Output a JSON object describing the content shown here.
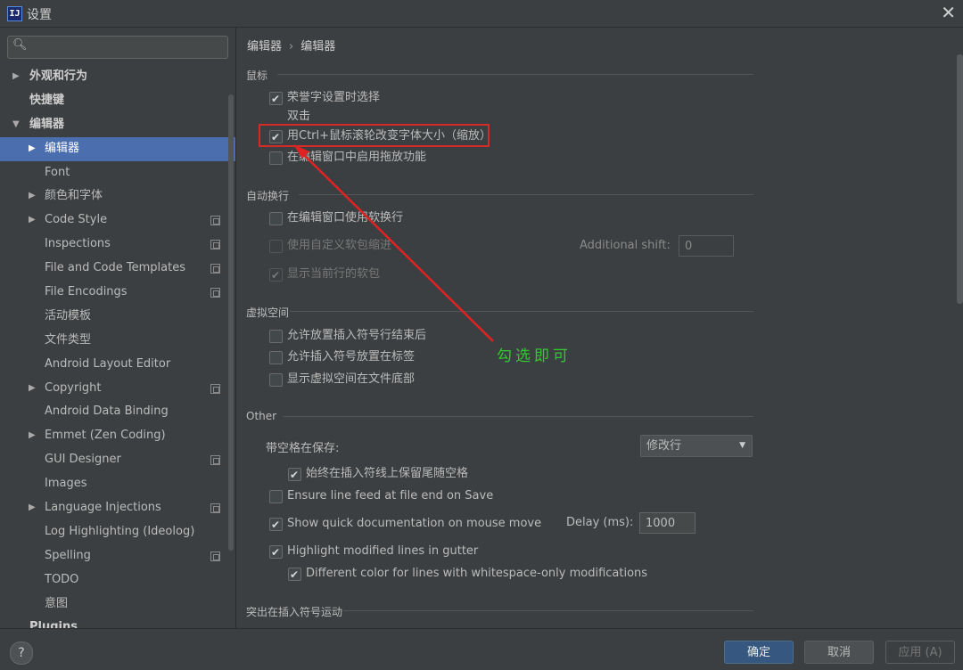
{
  "window": {
    "title": "设置",
    "app_icon": "IJ",
    "close_glyph": "✕"
  },
  "search": {
    "placeholder": "",
    "icon": "search-icon"
  },
  "tree": [
    {
      "label": "外观和行为",
      "level": 0,
      "arrow": "▶",
      "bold": true
    },
    {
      "label": "快捷键",
      "level": 0,
      "arrow": "",
      "bold": true
    },
    {
      "label": "编辑器",
      "level": 0,
      "arrow": "▼",
      "bold": true
    },
    {
      "label": "编辑器",
      "level": 1,
      "arrow": "▶",
      "selected": true
    },
    {
      "label": "Font",
      "level": 1,
      "arrow": ""
    },
    {
      "label": "颜色和字体",
      "level": 1,
      "arrow": "▶"
    },
    {
      "label": "Code Style",
      "level": 1,
      "arrow": "▶",
      "copy": true
    },
    {
      "label": "Inspections",
      "level": 1,
      "arrow": "",
      "copy": true
    },
    {
      "label": "File and Code Templates",
      "level": 1,
      "arrow": "",
      "copy": true
    },
    {
      "label": "File Encodings",
      "level": 1,
      "arrow": "",
      "copy": true
    },
    {
      "label": "活动模板",
      "level": 1,
      "arrow": ""
    },
    {
      "label": "文件类型",
      "level": 1,
      "arrow": ""
    },
    {
      "label": "Android Layout Editor",
      "level": 1,
      "arrow": ""
    },
    {
      "label": "Copyright",
      "level": 1,
      "arrow": "▶",
      "copy": true
    },
    {
      "label": "Android Data Binding",
      "level": 1,
      "arrow": ""
    },
    {
      "label": "Emmet (Zen Coding)",
      "level": 1,
      "arrow": "▶"
    },
    {
      "label": "GUI Designer",
      "level": 1,
      "arrow": "",
      "copy": true
    },
    {
      "label": "Images",
      "level": 1,
      "arrow": ""
    },
    {
      "label": "Language Injections",
      "level": 1,
      "arrow": "▶",
      "copy": true
    },
    {
      "label": "Log Highlighting (Ideolog)",
      "level": 1,
      "arrow": ""
    },
    {
      "label": "Spelling",
      "level": 1,
      "arrow": "",
      "copy": true
    },
    {
      "label": "TODO",
      "level": 1,
      "arrow": ""
    },
    {
      "label": "意图",
      "level": 1,
      "arrow": ""
    },
    {
      "label": "Plugins",
      "level": 0,
      "arrow": "",
      "bold": true
    }
  ],
  "breadcrumb": {
    "part1": "编辑器",
    "sep": "›",
    "part2": "编辑器"
  },
  "sections": {
    "mouse": "鼠标",
    "soft_wrap": "自动换行",
    "virtual_space": "虚拟空间",
    "other": "Other",
    "caret": "突出在插入符号运动"
  },
  "checkboxes": {
    "honor_camel": {
      "label": "荣誉字设置时选择",
      "checked": true
    },
    "double_click": "双击",
    "ctrl_wheel_zoom": {
      "label": "用Ctrl+鼠标滚轮改变字体大小（缩放）",
      "checked": true
    },
    "drag_drop": {
      "label": "在编辑窗口中启用拖放功能",
      "checked": false
    },
    "soft_wrap_editor": {
      "label": "在编辑窗口使用软换行",
      "checked": false
    },
    "custom_indent": {
      "label": "使用自定义软包缩进",
      "checked": false
    },
    "show_current_wrap": {
      "label": "显示当前行的软包",
      "checked": true
    },
    "caret_after_end": {
      "label": "允许放置插入符号行结束后",
      "checked": false
    },
    "caret_in_tabs": {
      "label": "允许插入符号放置在标签",
      "checked": false
    },
    "virtual_space_bottom": {
      "label": "显示虚拟空间在文件底部",
      "checked": false
    },
    "keep_trailing": {
      "label": "始终在插入符线上保留尾随空格",
      "checked": true
    },
    "ensure_lf": {
      "label": "Ensure line feed at file end on Save",
      "checked": false
    },
    "quick_doc": {
      "label": "Show quick documentation on mouse move",
      "checked": true
    },
    "highlight_modified": {
      "label": "Highlight modified lines in gutter",
      "checked": true
    },
    "diff_color_ws": {
      "label": "Different color for lines with whitespace-only modifications",
      "checked": true
    }
  },
  "fields": {
    "additional_shift_label": "Additional shift:",
    "additional_shift_value": "0",
    "strip_label": "带空格在保存:",
    "strip_value": "修改行",
    "delay_label": "Delay (ms):",
    "delay_value": "1000"
  },
  "annotation": {
    "text": "勾选即可",
    "color": "#2ecc2e",
    "box_color": "#d42a2a"
  },
  "buttons": {
    "help": "?",
    "ok": "确定",
    "cancel": "取消",
    "apply": "应用 (A)"
  }
}
